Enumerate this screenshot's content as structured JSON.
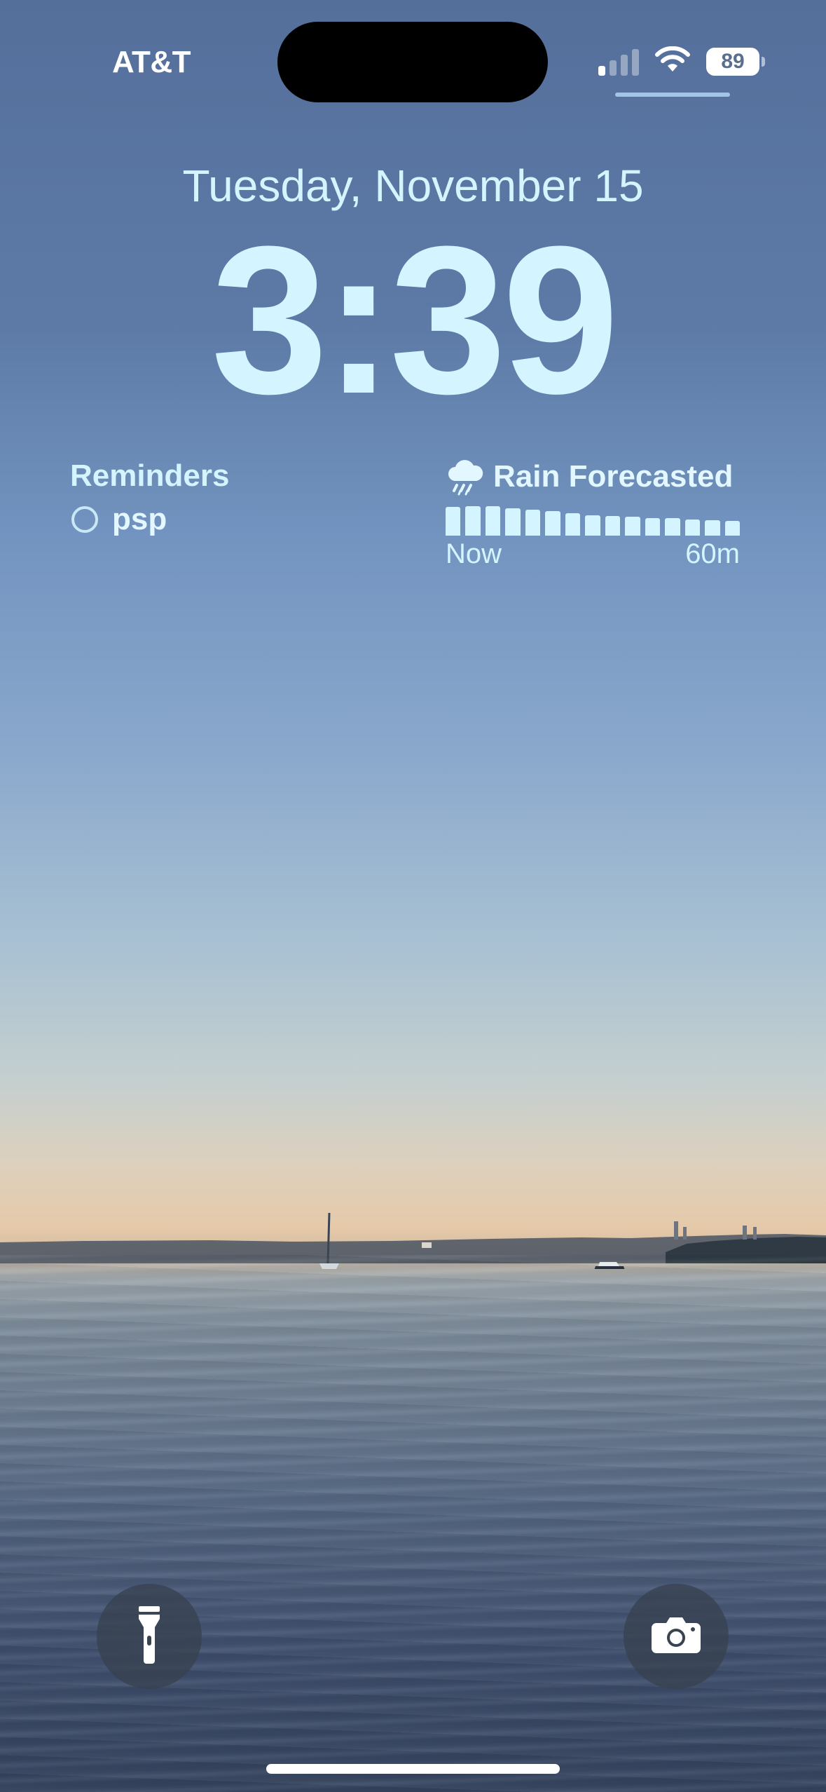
{
  "status_bar": {
    "carrier": "AT&T",
    "battery_level": "89",
    "signal_bars_active": 1,
    "signal_bars_total": 4,
    "wifi_icon": "wifi-icon"
  },
  "lock_screen": {
    "date": "Tuesday, November 15",
    "time": "3:39"
  },
  "reminders_widget": {
    "title": "Reminders",
    "items": [
      {
        "label": "psp",
        "completed": false
      }
    ]
  },
  "weather_widget": {
    "icon": "rain-cloud-icon",
    "title": "Rain Forecasted",
    "axis_start": "Now",
    "axis_end": "60m",
    "intensity": [
      0.58,
      0.6,
      0.6,
      0.56,
      0.53,
      0.5,
      0.46,
      0.42,
      0.4,
      0.38,
      0.36,
      0.35,
      0.33,
      0.31,
      0.3
    ]
  },
  "controls": {
    "left": "flashlight-icon",
    "right": "camera-icon"
  },
  "colors": {
    "accent_text": "#d4f4ff",
    "button_bg": "#374150"
  }
}
